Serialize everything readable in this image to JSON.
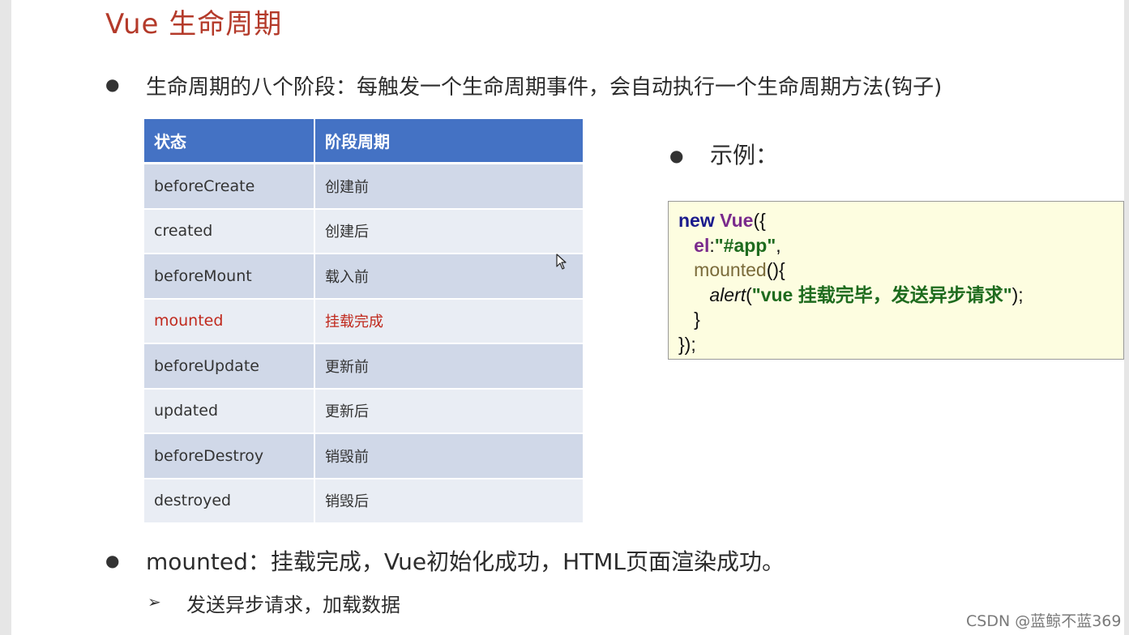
{
  "title": "Vue 生命周期",
  "bullets": {
    "intro": "生命周期的八个阶段：每触发一个生命周期事件，会自动执行一个生命周期方法(钩子)",
    "example_label": "示例：",
    "mounted_note": "mounted：挂载完成，Vue初始化成功，HTML页面渲染成功。",
    "sub_note": "发送异步请求，加载数据"
  },
  "table": {
    "headers": [
      "状态",
      "阶段周期"
    ],
    "rows": [
      {
        "state": "beforeCreate",
        "stage": "创建前"
      },
      {
        "state": "created",
        "stage": "创建后"
      },
      {
        "state": "beforeMount",
        "stage": "载入前"
      },
      {
        "state": "mounted",
        "stage": "挂载完成"
      },
      {
        "state": "beforeUpdate",
        "stage": "更新前"
      },
      {
        "state": "updated",
        "stage": "更新后"
      },
      {
        "state": "beforeDestroy",
        "stage": "销毁前"
      },
      {
        "state": "destroyed",
        "stage": "销毁后"
      }
    ],
    "highlight_row": "mounted"
  },
  "code": {
    "l1_kw": "new",
    "l1_cls": "Vue",
    "l1_rest": "({",
    "l2_prop": "el",
    "l2_colon": ":",
    "l2_str": "\"#app\"",
    "l2_rest": ",",
    "l3_fn": "mounted",
    "l3_rest": "(){",
    "l4_fn": "alert",
    "l4_open": "(",
    "l4_str": "\"vue 挂载完毕，发送异步请求\"",
    "l4_rest": ");",
    "l5": "}",
    "l6": "});"
  },
  "watermark": "CSDN @蓝鲸不蓝369",
  "colors": {
    "title": "#b43a2a",
    "table_header": "#4472c4",
    "row_odd": "#d0d8e8",
    "row_even": "#e9edf4",
    "highlight": "#c0291d",
    "code_bg": "#fdfde0"
  }
}
